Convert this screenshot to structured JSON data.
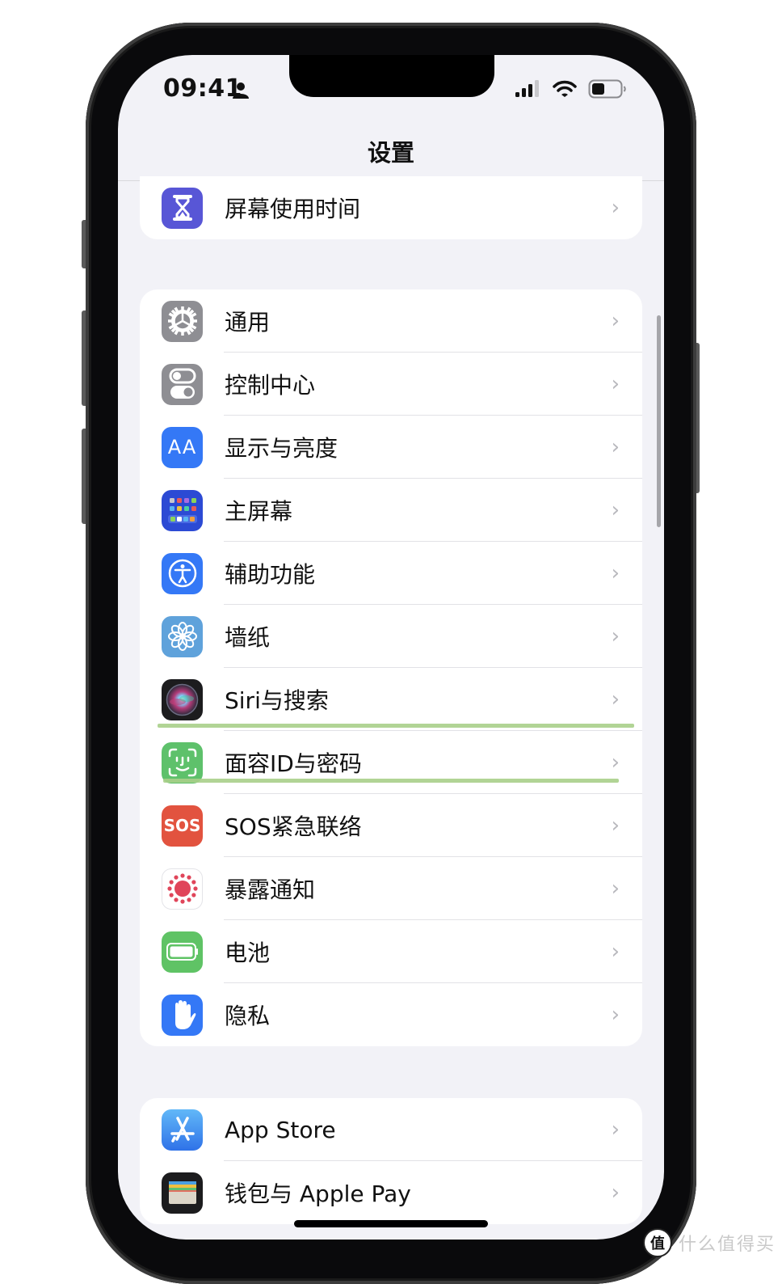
{
  "status_bar": {
    "time": "09:41",
    "signal_bars_active": 3,
    "signal_bars_total": 4,
    "battery_level": 0.45
  },
  "nav": {
    "title": "设置"
  },
  "groups": [
    {
      "items": [
        {
          "label": "屏幕使用时间",
          "icon": "hourglass-icon",
          "color": "#5856d6"
        }
      ]
    },
    {
      "items": [
        {
          "label": "通用",
          "icon": "gear-icon",
          "color": "#8e8e93"
        },
        {
          "label": "控制中心",
          "icon": "toggles-icon",
          "color": "#8e8e93"
        },
        {
          "label": "显示与亮度",
          "icon": "text-size-icon",
          "icon_text": "AA",
          "color": "#3478f6"
        },
        {
          "label": "主屏幕",
          "icon": "home-grid-icon",
          "color": "#2c4ad4"
        },
        {
          "label": "辅助功能",
          "icon": "accessibility-icon",
          "color": "#3478f6"
        },
        {
          "label": "墙纸",
          "icon": "flower-icon",
          "color": "#5fa2db"
        },
        {
          "label": "Siri与搜索",
          "icon": "siri-icon",
          "color": "#1c1c1e"
        },
        {
          "label": "面容ID与密码",
          "icon": "face-id-icon",
          "color": "#5ec16b"
        },
        {
          "label": "SOS紧急联络",
          "icon": "sos-icon",
          "icon_text": "SOS",
          "color": "#e2533f"
        },
        {
          "label": "暴露通知",
          "icon": "exposure-icon",
          "color": "#ffffff"
        },
        {
          "label": "电池",
          "icon": "battery-icon",
          "color": "#5fc365"
        },
        {
          "label": "隐私",
          "icon": "hand-icon",
          "color": "#3478f6"
        }
      ]
    },
    {
      "items": [
        {
          "label": "App Store",
          "icon": "app-store-icon",
          "color": "#2f8af5"
        },
        {
          "label": "钱包与 Apple Pay",
          "icon": "wallet-icon",
          "color": "#1c1c1e"
        }
      ]
    }
  ],
  "chevron": "›",
  "highlight_color": "#a9cf8a",
  "watermark": {
    "logo": "值",
    "text": "什么值得买"
  }
}
